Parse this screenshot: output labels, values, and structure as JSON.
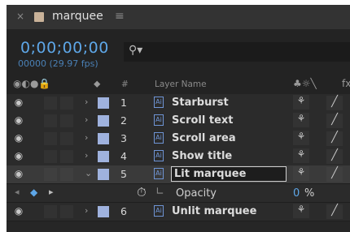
{
  "tab": {
    "close_icon": "×",
    "title": "marquee",
    "menu_icon": "≡",
    "swatch_color": "#c9b299"
  },
  "timecode": {
    "value": "0;00;00;00",
    "fps": "00000 (29.97 fps)"
  },
  "search": {
    "icon": "⚲▾",
    "placeholder": ""
  },
  "header": {
    "av_icons": "◉◐●🔒",
    "label_icon": "⬥",
    "hash": "#",
    "layer_name": "Layer Name",
    "switch_icons": "♣☼╲",
    "fx": "fx"
  },
  "layers": [
    {
      "num": "1",
      "name": "Starburst",
      "shy": "⚘",
      "switch": "╱"
    },
    {
      "num": "2",
      "name": "Scroll text",
      "shy": "⚘",
      "switch": "╱"
    },
    {
      "num": "3",
      "name": "Scroll area",
      "shy": "⚘",
      "switch": "╱"
    },
    {
      "num": "4",
      "name": "Show title",
      "shy": "⚘",
      "switch": "╱"
    },
    {
      "num": "5",
      "name": "Lit marquee",
      "shy": "⚘",
      "switch": "╱"
    },
    {
      "num": "6",
      "name": "Unlit marquee",
      "shy": "⚘",
      "switch": "╱"
    }
  ],
  "property": {
    "name": "Opacity",
    "value": "0",
    "unit": "%"
  },
  "colors": {
    "accent": "#5ea7e8",
    "label_swatch": "#9fb2de"
  }
}
